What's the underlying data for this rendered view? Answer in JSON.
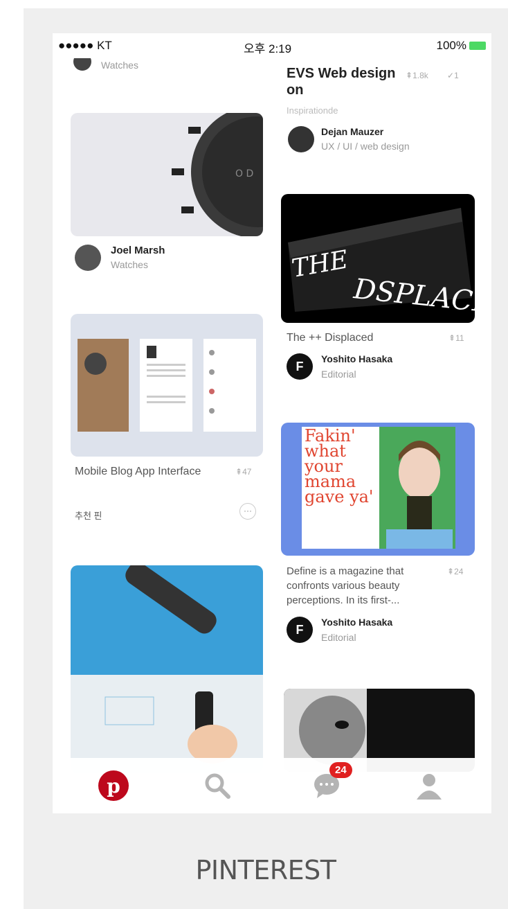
{
  "status_bar": {
    "carrier": "●●●●● KT",
    "time": "오후 2:19",
    "battery": "100%"
  },
  "left_column": {
    "top_board": "Watches",
    "pin1": {
      "author": "Joel Marsh",
      "board": "Watches"
    },
    "pin2": {
      "title": "Mobile Blog App Interface",
      "count": "47",
      "note": "추천 핀"
    }
  },
  "right_column": {
    "pin1": {
      "title": "EVS Web design on",
      "count": "1.8k",
      "check": "1",
      "source": "Inspirationde",
      "author": "Dejan Mauzer",
      "board": "UX / UI / web design"
    },
    "pin2": {
      "image_text_1": "THE",
      "image_text_2": "DSPLACED",
      "title": "The ++ Displaced",
      "count": "11",
      "author": "Yoshito Hasaka",
      "board": "Editorial"
    },
    "pin3": {
      "magazine_text": [
        "Fakin'",
        "what",
        "your",
        "mama",
        "gave ya'"
      ],
      "title": "Define is a magazine that confronts various beauty perceptions. In its first-...",
      "count": "24",
      "author": "Yoshito Hasaka",
      "board": "Editorial"
    }
  },
  "tabbar": {
    "messages_badge": "24"
  },
  "caption": "PINTEREST",
  "colors": {
    "brand": "#bd081c",
    "badge": "#e02020",
    "icon_gray": "#b4b4b4"
  },
  "icons": [
    "pinterest-icon",
    "search-icon",
    "messages-icon",
    "profile-icon",
    "more-icon",
    "check-icon",
    "pin-icon"
  ]
}
